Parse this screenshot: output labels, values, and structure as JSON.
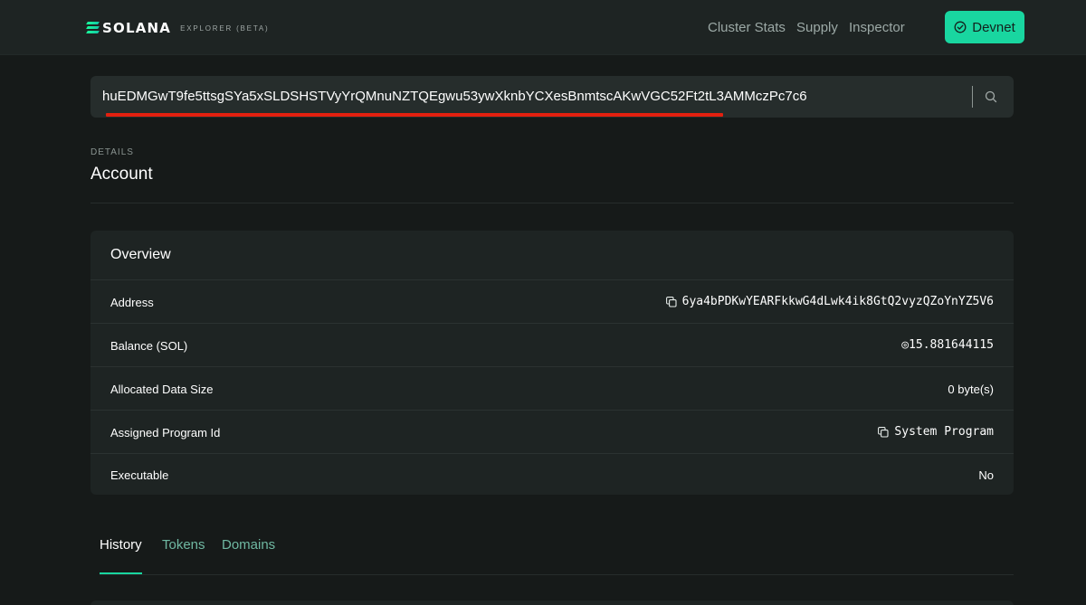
{
  "header": {
    "logo_word": "SOLANA",
    "logo_sub": "EXPLORER (BETA)",
    "nav": [
      {
        "label": "Cluster Stats"
      },
      {
        "label": "Supply"
      },
      {
        "label": "Inspector"
      }
    ],
    "cluster_button": "Devnet"
  },
  "search": {
    "value": "huEDMGwT9fe5ttsgSYa5xSLDSHSTVyYrQMnuNZTQEgwu53ywXknbYCXesBnmtscAKwVGC52Ft2tL3AMMczPc7c6"
  },
  "details": {
    "pretitle": "DETAILS",
    "title": "Account"
  },
  "overview": {
    "title": "Overview",
    "rows": [
      {
        "label": "Address",
        "value": "6ya4bPDKwYEARFkkwG4dLwk4ik8GtQ2vyzQZoYnYZ5V6"
      },
      {
        "label": "Balance (SOL)",
        "value": "◎15.881644115"
      },
      {
        "label": "Allocated Data Size",
        "value": "0 byte(s)"
      },
      {
        "label": "Assigned Program Id",
        "value": "System Program"
      },
      {
        "label": "Executable",
        "value": "No"
      }
    ]
  },
  "tabs": [
    {
      "label": "History",
      "active": true
    },
    {
      "label": "Tokens",
      "active": false
    },
    {
      "label": "Domains",
      "active": false
    }
  ],
  "colors": {
    "accent": "#19d6a0",
    "background": "#161a19",
    "card": "#1e2423",
    "highlight": "#e3200f"
  },
  "icons": [
    "solana-logo-icon",
    "check-circle-icon",
    "search-icon",
    "copy-icon"
  ]
}
